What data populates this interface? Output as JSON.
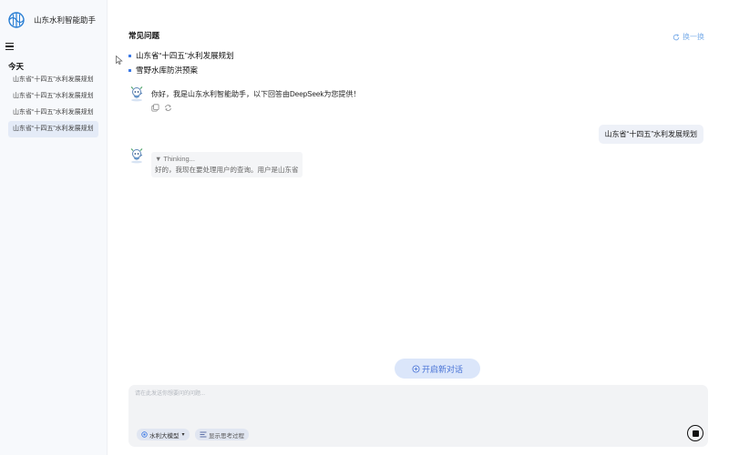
{
  "app": {
    "title": "山东水利智能助手"
  },
  "sidebar": {
    "section_today": "今天",
    "items": [
      {
        "label": "山东省“十四五”水利发展规划",
        "active": false
      },
      {
        "label": "山东省“十四五”水利发展规划",
        "active": false
      },
      {
        "label": "山东省“十四五”水利发展规划",
        "active": false
      },
      {
        "label": "山东省“十四五”水利发展规划",
        "active": true
      }
    ]
  },
  "faq": {
    "title": "常见问题",
    "refresh_label": "换一换",
    "items": [
      "山东省“十四五”水利发展规划",
      "雪野水库防洪预案"
    ]
  },
  "chat": {
    "greeting": "你好，我是山东水利智能助手，以下回答由DeepSeek为您提供！",
    "user_message": "山东省“十四五”水利发展规划",
    "thinking_label": "▼ Thinking...",
    "thinking_text": "好的，我现在要处理用户的查询。用户是山东省"
  },
  "composer": {
    "new_chat_label": "开启新对话",
    "placeholder": "请在此发送你想要问的问题...",
    "value": "",
    "model_label": "水利大模型",
    "show_thinking_label": "显示思考过程"
  },
  "colors": {
    "accent": "#3d7ae5",
    "refresh": "#7fb0ea",
    "new_chat_bg": "#dbe6fa",
    "composer_bg": "#f2f3f5"
  }
}
